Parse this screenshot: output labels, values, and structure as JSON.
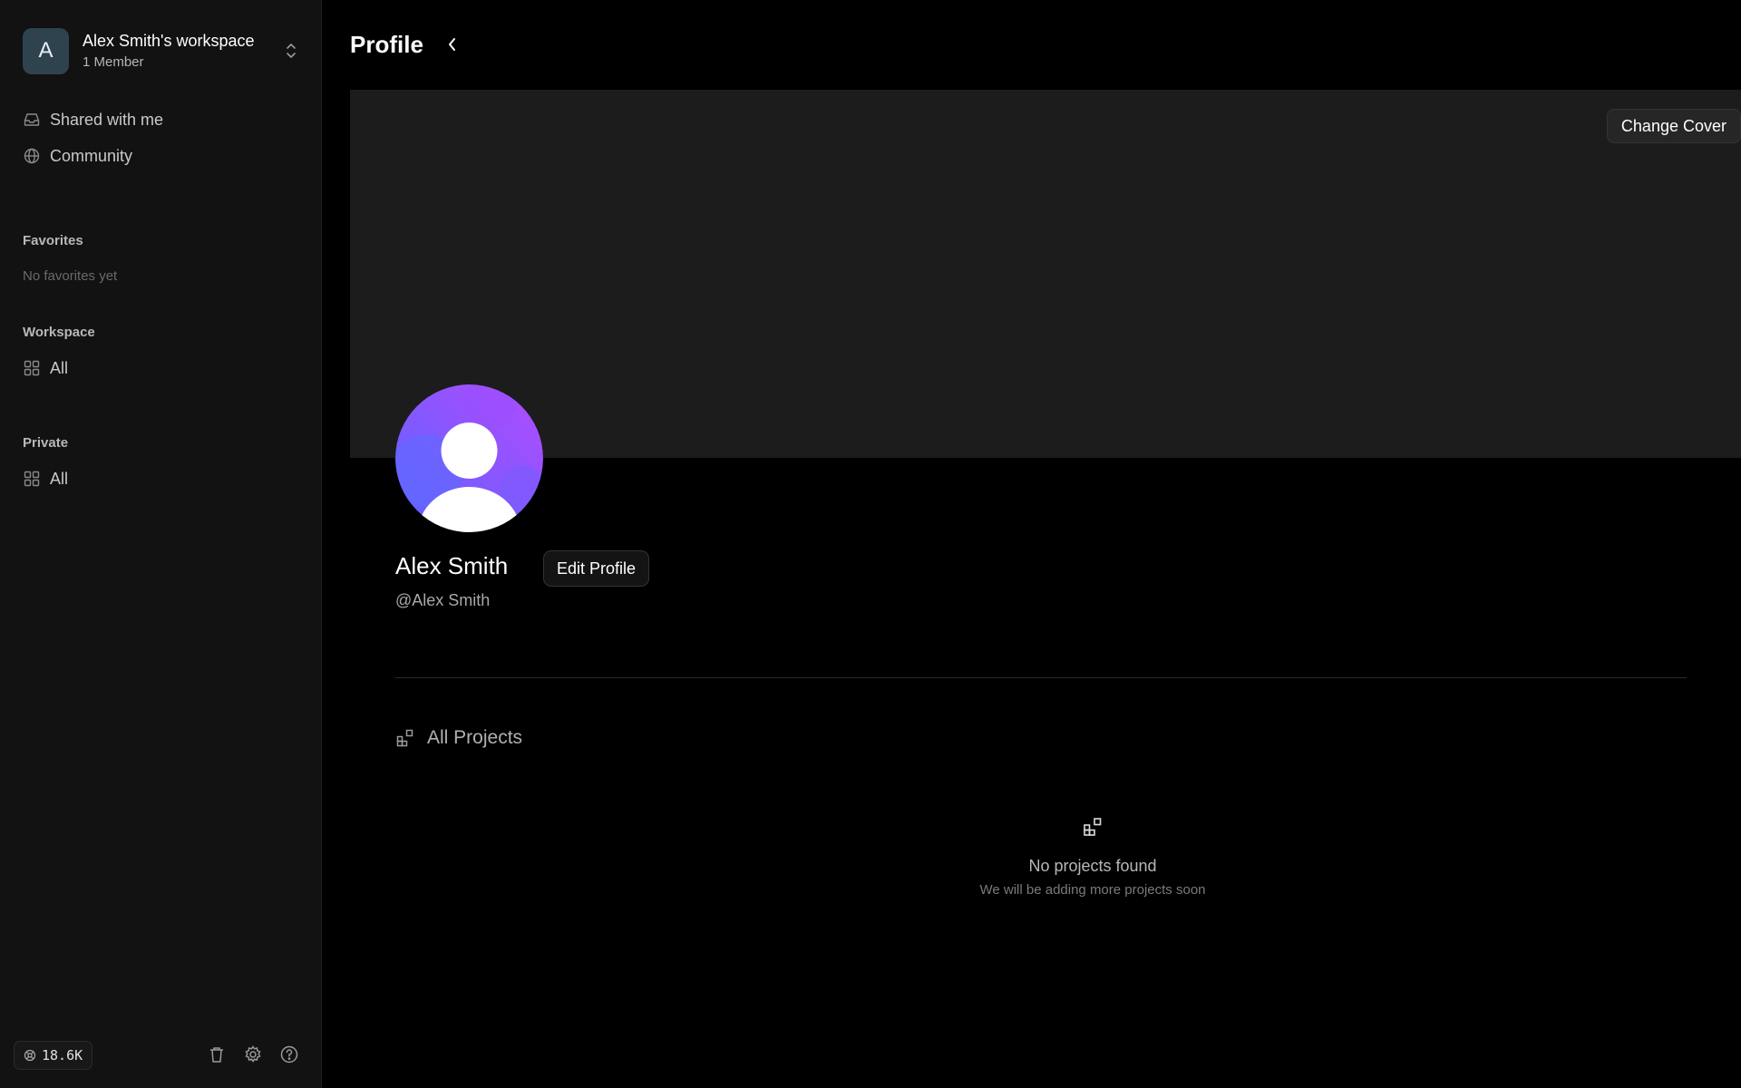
{
  "sidebar": {
    "workspace": {
      "initial": "A",
      "name": "Alex Smith's workspace",
      "members": "1 Member"
    },
    "nav": [
      {
        "label": "Shared with me",
        "icon": "inbox-icon"
      },
      {
        "label": "Community",
        "icon": "globe-icon"
      }
    ],
    "favorites": {
      "title": "Favorites",
      "empty_text": "No favorites yet"
    },
    "workspace_section": {
      "title": "Workspace",
      "item": "All"
    },
    "private_section": {
      "title": "Private",
      "item": "All"
    },
    "footer": {
      "credits": "18.6K"
    }
  },
  "main": {
    "title": "Profile",
    "change_cover": "Change Cover",
    "profile": {
      "name": "Alex Smith",
      "handle": "@Alex Smith",
      "edit_label": "Edit Profile"
    },
    "projects": {
      "heading": "All Projects",
      "empty_title": "No projects found",
      "empty_subtitle": "We will be adding more projects soon"
    }
  },
  "colors": {
    "background": "#000000",
    "sidebar": "#121212",
    "cover": "#1c1c1c",
    "avatar_gradient_start": "#6a5cff",
    "avatar_gradient_end": "#b04dff"
  }
}
